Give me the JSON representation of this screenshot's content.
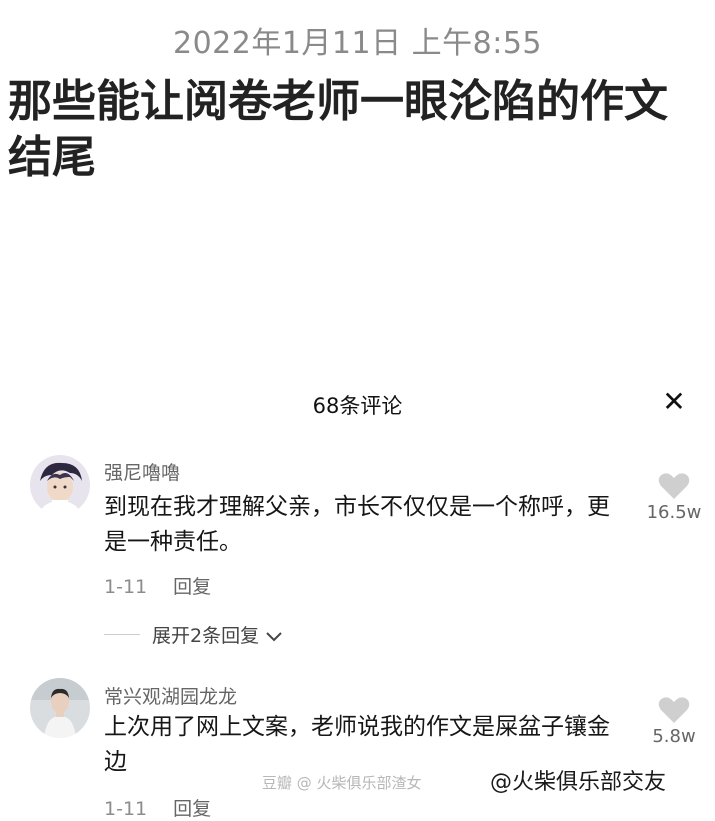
{
  "post": {
    "timestamp": "2022年1月11日 上午8:55",
    "title": "那些能让阅卷老师一眼沦陷的作文结尾"
  },
  "comments_sheet": {
    "count_label": "68条评论",
    "close_glyph": "✕"
  },
  "comments": [
    {
      "author": "强尼嚕嚕",
      "text": "到现在我才理解父亲，市长不仅仅是一个称呼，更是一种责任。",
      "date": "1-11",
      "reply_label": "回复",
      "likes": "16.5w",
      "expand_label": "展开2条回复"
    },
    {
      "author": "常兴观湖园龙龙",
      "text": "上次用了网上文案，老师说我的作文是屎盆子镶金边",
      "date": "1-11",
      "reply_label": "回复",
      "likes": "5.8w"
    }
  ],
  "watermarks": {
    "left": "豆瓣  @ 火柴俱乐部渣女",
    "right": "@火柴俱乐部交友"
  },
  "icons": {
    "close": "close-icon",
    "like": "heart-icon",
    "expand": "chevron-down-icon"
  },
  "colors": {
    "heart": "#cfcfcf",
    "text_primary": "#161616",
    "text_secondary": "#8c8c8c"
  }
}
